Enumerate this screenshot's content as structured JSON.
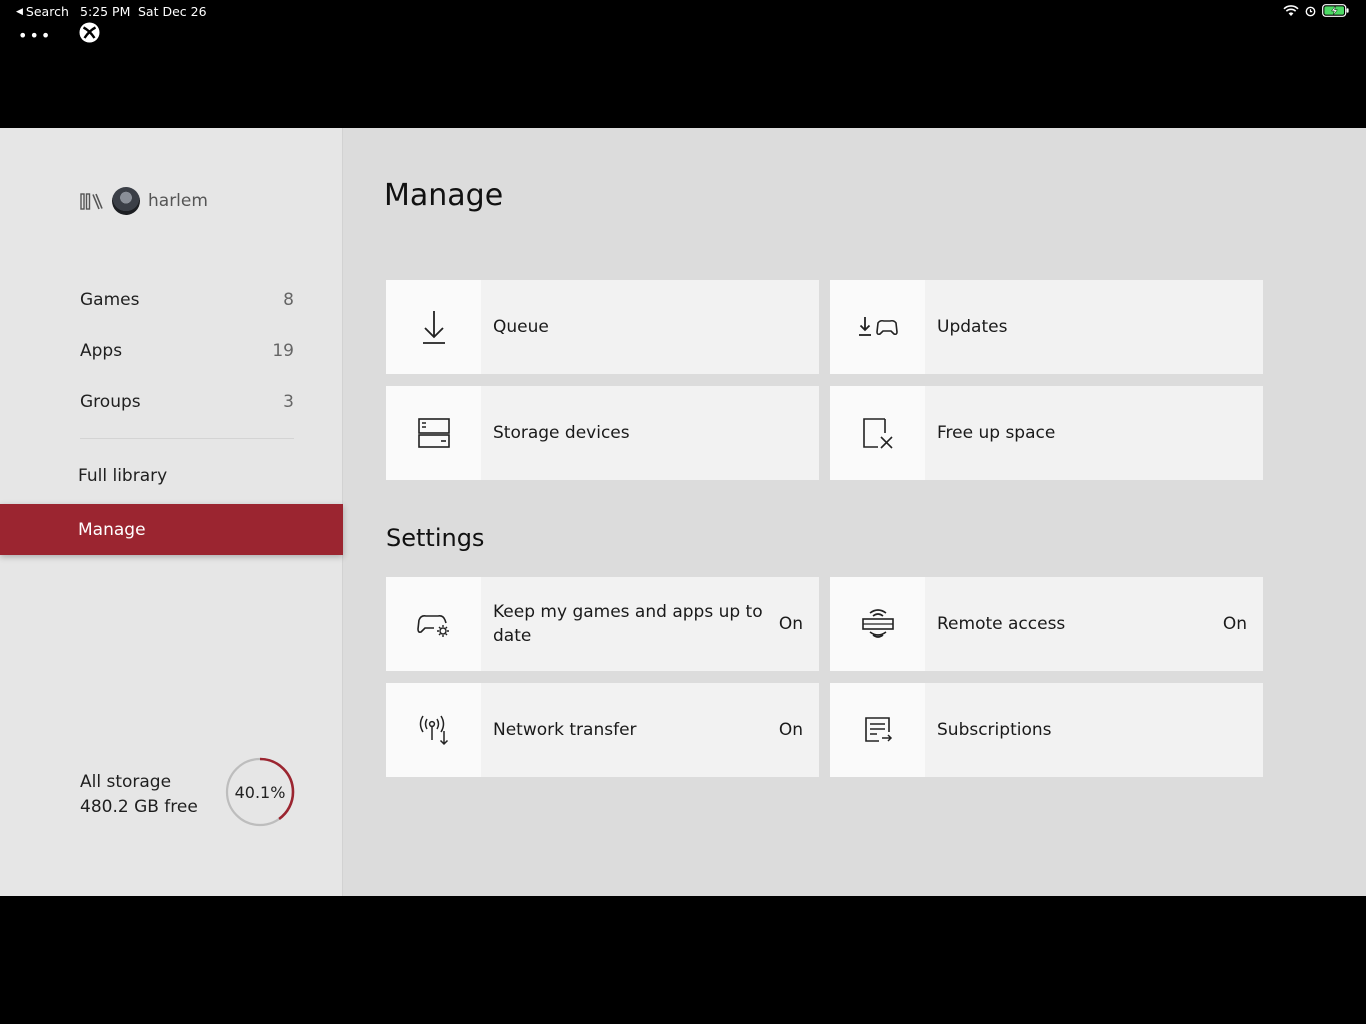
{
  "status_bar": {
    "back_label": "Search",
    "time": "5:25 PM",
    "date": "Sat Dec 26"
  },
  "sidebar": {
    "username": "harlem",
    "nav": [
      {
        "label": "Games",
        "count": "8"
      },
      {
        "label": "Apps",
        "count": "19"
      },
      {
        "label": "Groups",
        "count": "3"
      }
    ],
    "full_library": "Full library",
    "manage": "Manage",
    "storage": {
      "title": "All storage",
      "free": "480.2 GB free",
      "percent_label": "40.1%",
      "percent_value": 40.1
    }
  },
  "main": {
    "title": "Manage",
    "tiles": [
      {
        "label": "Queue",
        "icon": "download-icon"
      },
      {
        "label": "Updates",
        "icon": "download-controller-icon"
      },
      {
        "label": "Storage devices",
        "icon": "storage-devices-icon"
      },
      {
        "label": "Free up space",
        "icon": "free-space-icon"
      }
    ],
    "settings_title": "Settings",
    "settings": [
      {
        "label": "Keep my games and apps up to date",
        "value": "On",
        "icon": "controller-gear-icon"
      },
      {
        "label": "Remote access",
        "value": "On",
        "icon": "remote-console-icon"
      },
      {
        "label": "Network transfer",
        "value": "On",
        "icon": "network-transfer-icon"
      },
      {
        "label": "Subscriptions",
        "value": "",
        "icon": "subscriptions-icon"
      }
    ]
  },
  "colors": {
    "accent": "#9b2530",
    "background": "#dcdcdc",
    "sidebar": "#e6e6e6",
    "tile": "#f2f2f2"
  }
}
